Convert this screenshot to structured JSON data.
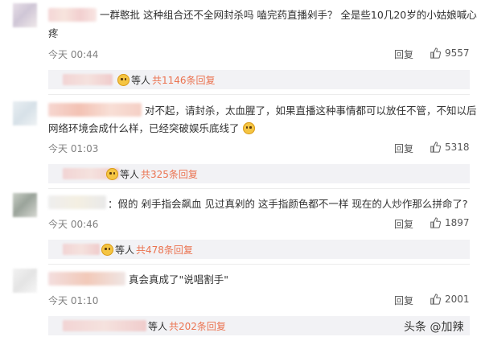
{
  "comments": [
    {
      "text_line1": "一群憨批  这种组合还不全网封杀吗  嗑完药直播剁手？ 全是些10几20岁的小姑娘喊心",
      "text_line2": "疼",
      "time": "今天 00:44",
      "reply_label": "回复",
      "likes": "9557",
      "sub_suffix": "等人",
      "sub_count": "共1146条回复"
    },
    {
      "text_line1": "对不起，请封杀，太血腥了，如果直播这种事情都可以放任不管，不知以后",
      "text_line2": "网络环境会成什么样，已经突破娱乐底线了",
      "time": "今天 01:03",
      "reply_label": "回复",
      "likes": "5318",
      "sub_suffix": "等人",
      "sub_count": "共325条回复"
    },
    {
      "text_line1": "：假的 剁手指会飙血 见过真剁的 这手指颜色都不一样 现在的人炒作那么拼命了?",
      "time": "今天 00:46",
      "reply_label": "回复",
      "likes": "1897",
      "sub_suffix": "等人",
      "sub_count": "共478条回复"
    },
    {
      "text_line1": "真会真成了\"说唱割手\"",
      "time": "今天 01:10",
      "reply_label": "回复",
      "likes": "2001",
      "sub_suffix": "等人",
      "sub_count": "共202条回复"
    }
  ],
  "watermark": "头条 @加辣",
  "colors": {
    "accent": "#eb7350",
    "subbg": "#f2f2f5",
    "muted": "#808080"
  }
}
